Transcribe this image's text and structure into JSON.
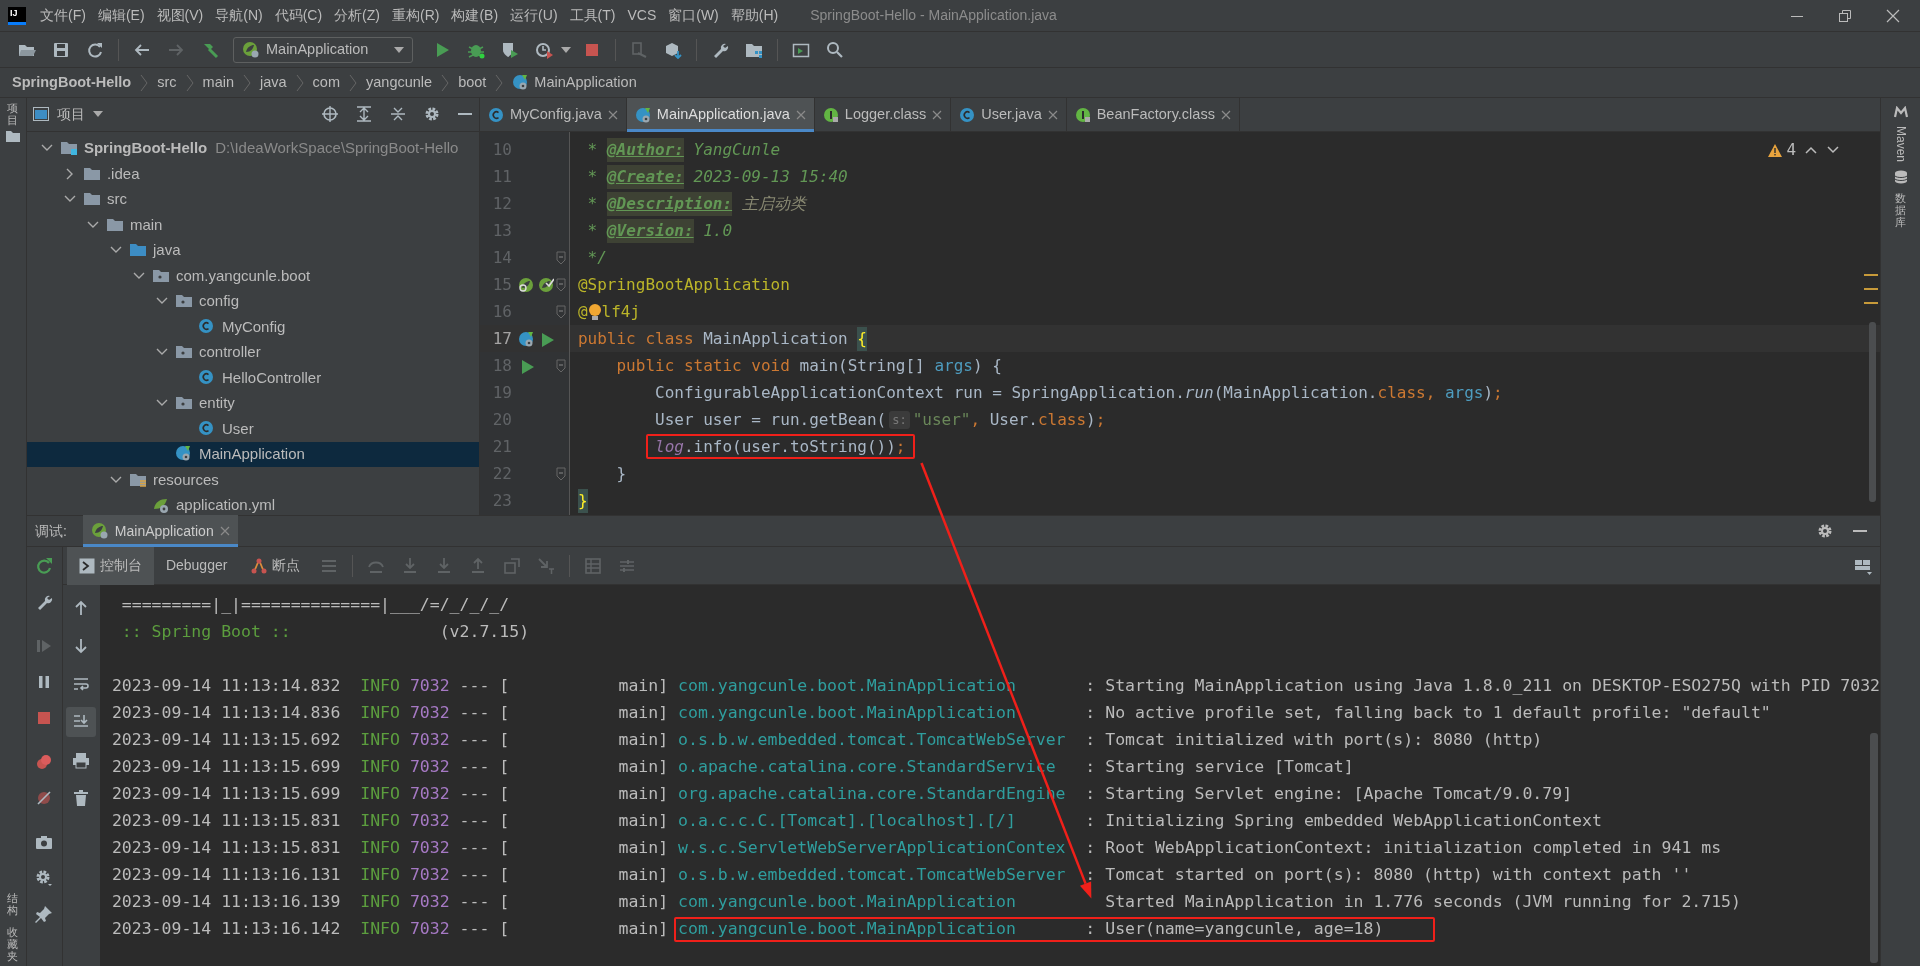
{
  "app_logo": "IJ",
  "menu": [
    "文件(F)",
    "编辑(E)",
    "视图(V)",
    "导航(N)",
    "代码(C)",
    "分析(Z)",
    "重构(R)",
    "构建(B)",
    "运行(U)",
    "工具(T)",
    "VCS",
    "窗口(W)",
    "帮助(H)"
  ],
  "window_title": "SpringBoot-Hello - MainApplication.java",
  "toolbar": {
    "run_config": "MainApplication"
  },
  "breadcrumb": [
    {
      "label": "SpringBoot-Hello",
      "bold": true
    },
    {
      "label": "src",
      "bold": false
    },
    {
      "label": "main",
      "bold": false
    },
    {
      "label": "java",
      "bold": false
    },
    {
      "label": "com",
      "bold": false
    },
    {
      "label": "yangcunle",
      "bold": false
    },
    {
      "label": "boot",
      "bold": false
    },
    {
      "label": "MainApplication",
      "bold": false
    }
  ],
  "left_strip": {
    "top": "项目",
    "bottom": [
      "结构",
      "收藏夹"
    ]
  },
  "project_panel": {
    "title": "项目",
    "tree": [
      {
        "label": "SpringBoot-Hello",
        "path": "D:\\IdeaWorkSpace\\SpringBoot-Hello",
        "kind": "module",
        "expanded": true,
        "selected": false,
        "children": [
          {
            "label": ".idea",
            "kind": "folder",
            "expanded": false,
            "selected": false
          },
          {
            "label": "src",
            "kind": "folder",
            "expanded": true,
            "selected": false,
            "children": [
              {
                "label": "main",
                "kind": "folder",
                "expanded": true,
                "selected": false,
                "children": [
                  {
                    "label": "java",
                    "kind": "source",
                    "expanded": true,
                    "selected": false,
                    "children": [
                      {
                        "label": "com.yangcunle.boot",
                        "kind": "package",
                        "expanded": true,
                        "selected": false,
                        "children": [
                          {
                            "label": "config",
                            "kind": "package",
                            "expanded": true,
                            "selected": false,
                            "children": [
                              {
                                "label": "MyConfig",
                                "kind": "class",
                                "selected": false
                              }
                            ]
                          },
                          {
                            "label": "controller",
                            "kind": "package",
                            "expanded": true,
                            "selected": false,
                            "children": [
                              {
                                "label": "HelloController",
                                "kind": "class",
                                "selected": false
                              }
                            ]
                          },
                          {
                            "label": "entity",
                            "kind": "package",
                            "expanded": true,
                            "selected": false,
                            "children": [
                              {
                                "label": "User",
                                "kind": "class",
                                "selected": false
                              }
                            ]
                          },
                          {
                            "label": "MainApplication",
                            "kind": "main",
                            "selected": true
                          }
                        ]
                      }
                    ]
                  },
                  {
                    "label": "resources",
                    "kind": "resources",
                    "expanded": true,
                    "selected": false,
                    "children": [
                      {
                        "label": "application.yml",
                        "kind": "yaml",
                        "selected": false
                      }
                    ]
                  }
                ]
              }
            ]
          }
        ]
      }
    ]
  },
  "editor": {
    "tabs": [
      {
        "label": "MyConfig.java",
        "kind": "class",
        "selected": false
      },
      {
        "label": "MainApplication.java",
        "kind": "main",
        "selected": true
      },
      {
        "label": "Logger.class",
        "kind": "interface",
        "selected": false
      },
      {
        "label": "User.java",
        "kind": "class",
        "selected": false
      },
      {
        "label": "BeanFactory.class",
        "kind": "interface",
        "selected": false
      }
    ],
    "warnings": "4",
    "lines": [
      {
        "number": "10",
        "current": false,
        "highlighted": false,
        "tokens": [
          {
            "kind": "doc",
            "text": " * "
          },
          {
            "kind": "doctag",
            "text": "@Author:"
          },
          {
            "kind": "doc",
            "text": " YangCunle"
          }
        ]
      },
      {
        "number": "11",
        "current": false,
        "highlighted": false,
        "tokens": [
          {
            "kind": "doc",
            "text": " * "
          },
          {
            "kind": "doctag",
            "text": "@Create:"
          },
          {
            "kind": "doc",
            "text": " 2023-09-13 15:40"
          }
        ]
      },
      {
        "number": "12",
        "current": false,
        "highlighted": false,
        "tokens": [
          {
            "kind": "doc",
            "text": " * "
          },
          {
            "kind": "doctag",
            "text": "@Description:"
          },
          {
            "kind": "docgray",
            "text": " 主启动类"
          }
        ]
      },
      {
        "number": "13",
        "current": false,
        "highlighted": false,
        "tokens": [
          {
            "kind": "doc",
            "text": " * "
          },
          {
            "kind": "doctag",
            "text": "@Version:"
          },
          {
            "kind": "doc",
            "text": " 1.0"
          }
        ]
      },
      {
        "number": "14",
        "current": false,
        "highlighted": false,
        "tokens": [
          {
            "kind": "doc",
            "text": " */"
          }
        ]
      },
      {
        "number": "15",
        "current": false,
        "highlighted": false,
        "tokens": [
          {
            "kind": "annotation",
            "text": "@SpringBootApplication"
          }
        ]
      },
      {
        "number": "16",
        "current": false,
        "highlighted": false,
        "tokens": [
          {
            "kind": "annotation",
            "text": "@"
          },
          {
            "kind": "bulb"
          },
          {
            "kind": "annotation",
            "text": "lf4j"
          }
        ]
      },
      {
        "number": "17",
        "current": true,
        "highlighted": false,
        "tokens": [
          {
            "kind": "keyword",
            "text": "public class "
          },
          {
            "kind": "plain",
            "text": "MainApplication "
          },
          {
            "kind": "match",
            "text": "{"
          }
        ]
      },
      {
        "number": "18",
        "current": false,
        "highlighted": false,
        "tokens": [
          {
            "kind": "keyword",
            "text": "    public static void "
          },
          {
            "kind": "plain",
            "text": "main(String[] "
          },
          {
            "kind": "param",
            "text": "args"
          },
          {
            "kind": "plain",
            "text": ") {"
          }
        ]
      },
      {
        "number": "19",
        "current": false,
        "highlighted": false,
        "tokens": [
          {
            "kind": "plain",
            "text": "        ConfigurableApplicationContext run = SpringApplication."
          },
          {
            "kind": "static",
            "text": "run"
          },
          {
            "kind": "plain",
            "text": "(MainApplication."
          },
          {
            "kind": "keyword",
            "text": "class, "
          },
          {
            "kind": "param",
            "text": "args"
          },
          {
            "kind": "plain",
            "text": ")"
          },
          {
            "kind": "keyword",
            "text": ";"
          }
        ]
      },
      {
        "number": "20",
        "current": false,
        "highlighted": false,
        "tokens": [
          {
            "kind": "plain",
            "text": "        User user = run.getBean("
          },
          {
            "kind": "hint",
            "text": "s:"
          },
          {
            "kind": "string",
            "text": "\"user\""
          },
          {
            "kind": "keyword",
            "text": ", "
          },
          {
            "kind": "plain",
            "text": "User."
          },
          {
            "kind": "keyword",
            "text": "class"
          },
          {
            "kind": "plain",
            "text": ")"
          },
          {
            "kind": "keyword",
            "text": ";"
          }
        ]
      },
      {
        "number": "21",
        "current": false,
        "highlighted": true,
        "tokens": [
          {
            "kind": "field",
            "text": "        log"
          },
          {
            "kind": "plain",
            "text": ".info(user.toString())"
          },
          {
            "kind": "keyword",
            "text": ";"
          }
        ]
      },
      {
        "number": "22",
        "current": false,
        "highlighted": false,
        "tokens": [
          {
            "kind": "plain",
            "text": "    }"
          }
        ]
      },
      {
        "number": "23",
        "current": false,
        "highlighted": false,
        "tokens": [
          {
            "kind": "matchbg",
            "text": "}"
          }
        ]
      }
    ]
  },
  "right_strip": [
    "Maven",
    "数据库"
  ],
  "debug": {
    "label": "调试:",
    "session": "MainApplication",
    "tabs": [
      {
        "label": "控制台",
        "selected": true
      },
      {
        "label": "Debugger",
        "selected": false
      },
      {
        "label": "断点",
        "selected": false
      }
    ],
    "banner": [
      {
        "text": "=========|_|==============|___/=/_/_/_/"
      },
      {
        "text": ":: Spring Boot ::",
        "version": "(v2.7.15)"
      }
    ],
    "logs": [
      {
        "time": "2023-09-14 11:13:14.832",
        "level": "INFO",
        "pid": "7032",
        "sep": "---",
        "thread": "[           main]",
        "logger": "com.yangcunle.boot.MainApplication",
        "colon": ":",
        "message": "Starting MainApplication using Java 1.8.0_211 on DESKTOP-ESO275Q with PID 7032",
        "highlighted": false
      },
      {
        "time": "2023-09-14 11:13:14.836",
        "level": "INFO",
        "pid": "7032",
        "sep": "---",
        "thread": "[           main]",
        "logger": "com.yangcunle.boot.MainApplication",
        "colon": ":",
        "message": "No active profile set, falling back to 1 default profile: \"default\"",
        "highlighted": false
      },
      {
        "time": "2023-09-14 11:13:15.692",
        "level": "INFO",
        "pid": "7032",
        "sep": "---",
        "thread": "[           main]",
        "logger": "o.s.b.w.embedded.tomcat.TomcatWebServer",
        "colon": ":",
        "message": "Tomcat initialized with port(s): 8080 (http)",
        "highlighted": false
      },
      {
        "time": "2023-09-14 11:13:15.699",
        "level": "INFO",
        "pid": "7032",
        "sep": "---",
        "thread": "[           main]",
        "logger": "o.apache.catalina.core.StandardService",
        "colon": ":",
        "message": "Starting service [Tomcat]",
        "highlighted": false
      },
      {
        "time": "2023-09-14 11:13:15.699",
        "level": "INFO",
        "pid": "7032",
        "sep": "---",
        "thread": "[           main]",
        "logger": "org.apache.catalina.core.StandardEngine",
        "colon": ":",
        "message": "Starting Servlet engine: [Apache Tomcat/9.0.79]",
        "highlighted": false
      },
      {
        "time": "2023-09-14 11:13:15.831",
        "level": "INFO",
        "pid": "7032",
        "sep": "---",
        "thread": "[           main]",
        "logger": "o.a.c.c.C.[Tomcat].[localhost].[/]",
        "colon": ":",
        "message": "Initializing Spring embedded WebApplicationContext",
        "highlighted": false
      },
      {
        "time": "2023-09-14 11:13:15.831",
        "level": "INFO",
        "pid": "7032",
        "sep": "---",
        "thread": "[           main]",
        "logger": "w.s.c.ServletWebServerApplicationContex",
        "colon": ":",
        "message": "Root WebApplicationContext: initialization completed in 941 ms",
        "highlighted": false
      },
      {
        "time": "2023-09-14 11:13:16.131",
        "level": "INFO",
        "pid": "7032",
        "sep": "---",
        "thread": "[           main]",
        "logger": "o.s.b.w.embedded.tomcat.TomcatWebServer",
        "colon": ":",
        "message": "Tomcat started on port(s): 8080 (http) with context path ''",
        "highlighted": false
      },
      {
        "time": "2023-09-14 11:13:16.139",
        "level": "INFO",
        "pid": "7032",
        "sep": "---",
        "thread": "[           main]",
        "logger": "com.yangcunle.boot.MainApplication",
        "message": "Started MainApplication in 1.776 seconds (JVM running for 2.715)",
        "highlighted": false
      },
      {
        "time": "2023-09-14 11:13:16.142",
        "level": "INFO",
        "pid": "7032",
        "sep": "---",
        "thread": "[           main]",
        "logger": "com.yangcunle.boot.MainApplication",
        "colon": ":",
        "message": "User(name=yangcunle, age=18)",
        "highlighted": true
      }
    ]
  }
}
